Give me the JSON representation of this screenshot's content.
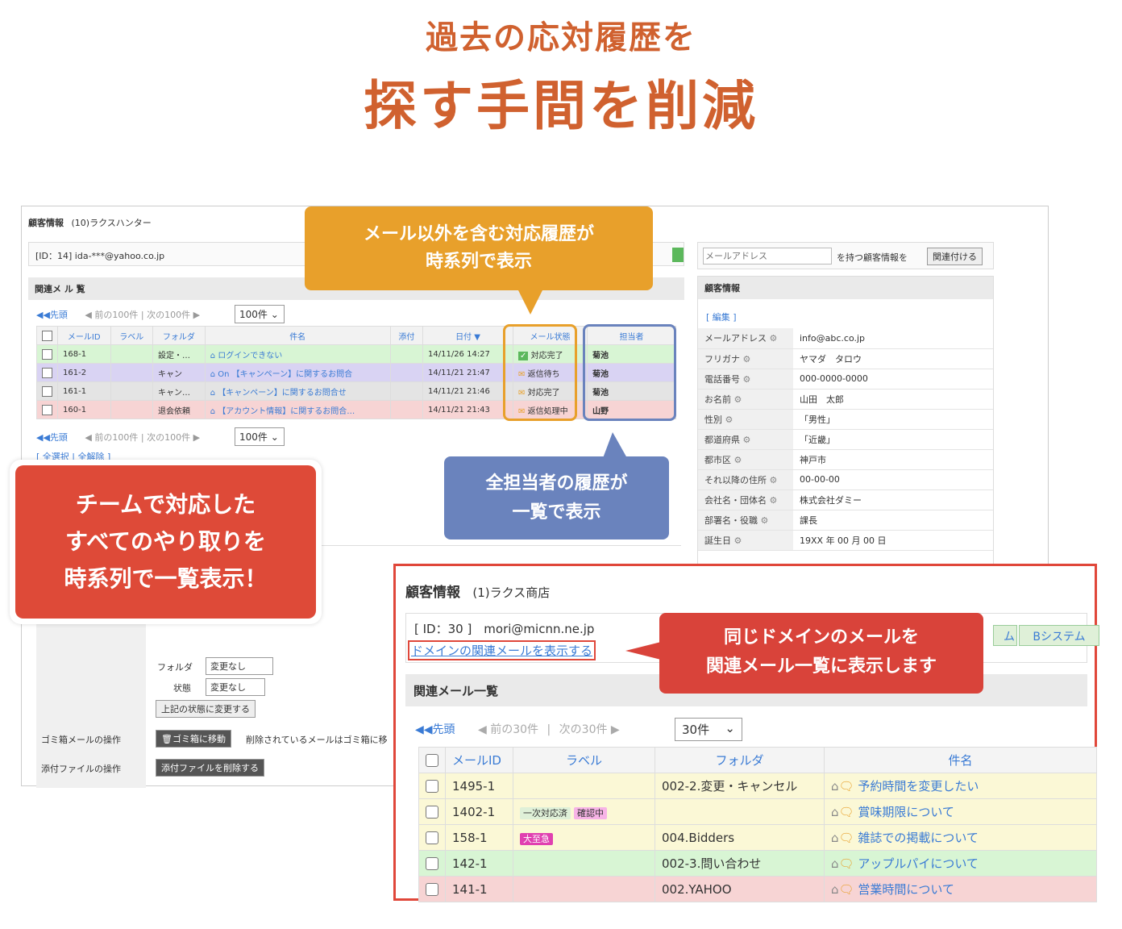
{
  "headline": {
    "line1": "過去の応対履歴を",
    "line2": "探す手間を削減"
  },
  "back": {
    "title": "顧客情報",
    "customer": "(10)ラクスハンター",
    "id_email": "[ID：14] ida-***@yahoo.co.jp",
    "related_heading": "関連メ ル 覧",
    "pager": {
      "first": "◀◀先頭",
      "prev": "◀ 前の100件",
      "next": "次の100件 ▶",
      "per_page": "100件"
    },
    "headers": [
      "メールID",
      "ラベル",
      "フォルダ",
      "件名",
      "添付",
      "日付 ▼",
      "メール状態",
      "担当者"
    ],
    "rows": [
      {
        "id": "168-1",
        "label": "",
        "folder": "設定・…",
        "subject": "ログインできない",
        "date": "14/11/26 14:27",
        "status": "対応完了",
        "agent": "菊池",
        "color": "green"
      },
      {
        "id": "161-2",
        "label": "",
        "folder": "キャン",
        "subject": "On 【キャンペーン】に関するお問合",
        "date": "14/11/21 21:47",
        "status": "返信待ち",
        "agent": "菊池",
        "color": "purple"
      },
      {
        "id": "161-1",
        "label": "",
        "folder": "キャン…",
        "subject": "【キャンペーン】に関するお問合せ",
        "date": "14/11/21 21:46",
        "status": "対応完了",
        "agent": "菊池",
        "color": "gray"
      },
      {
        "id": "160-1",
        "label": "",
        "folder": "退会依頼",
        "subject": "【アカウント情報】に関するお問合…",
        "date": "14/11/21 21:43",
        "status": "返信処理中",
        "agent": "山野",
        "color": "red"
      }
    ],
    "select_links": "[ 全選択 | 全解除 ]",
    "folder_label": "フォルダ",
    "folder_value": "変更なし",
    "status_label": "状態",
    "status_value": "変更なし",
    "apply_button": "上記の状態に変更する",
    "trash_label": "ゴミ箱メールの操作",
    "trash_button": "ゴミ箱に移動",
    "trash_note": "削除されているメールはゴミ箱に移",
    "attach_label": "添付ファイルの操作",
    "attach_button": "添付ファイルを削除する",
    "right": {
      "email_placeholder": "メールアドレス",
      "assoc_text": "を持つ顧客情報を",
      "assoc_button": "関連付ける",
      "panel_title": "顧客情報",
      "edit_link": "[ 編集 ]",
      "fields": [
        {
          "k": "メールアドレス",
          "v": "info@abc.co.jp"
        },
        {
          "k": "フリガナ",
          "v": "ヤマダ　タロウ"
        },
        {
          "k": "電話番号",
          "v": "000-0000-0000"
        },
        {
          "k": "お名前",
          "v": "山田　太郎"
        },
        {
          "k": "性別",
          "v": "「男性」"
        },
        {
          "k": "都道府県",
          "v": "「近畿」"
        },
        {
          "k": "都市区",
          "v": "神戸市"
        },
        {
          "k": "それ以降の住所",
          "v": "00-00-00"
        },
        {
          "k": "会社名・団体名",
          "v": "株式会社ダミー"
        },
        {
          "k": "部署名・役職",
          "v": "課長"
        },
        {
          "k": "誕生日",
          "v": "19XX 年 00 月 00 日"
        }
      ]
    }
  },
  "callouts": {
    "c1": [
      "メール以外を含む対応履歴が",
      "時系列で表示"
    ],
    "c2": [
      "全担当者の履歴が",
      "一覧で表示"
    ],
    "c3": [
      "チームで対応した",
      "すべてのやり取りを",
      "時系列で一覧表示！"
    ],
    "c4": [
      "同じドメインのメールを",
      "関連メール一覧に表示します"
    ]
  },
  "front": {
    "title": "顧客情報",
    "customer": "(1)ラクス商店",
    "id_email": "[ ID：30 ]　mori@micnn.ne.jp",
    "domain_link": "ドメインの関連メールを表示する",
    "tag_a": "ム",
    "tag_b": "Bシステム",
    "related_heading": "関連メール一覧",
    "pager": {
      "first": "◀◀先頭",
      "prev": "◀ 前の30件",
      "sep": "|",
      "next": "次の30件 ▶",
      "per_page": "30件"
    },
    "headers": [
      "メールID",
      "ラベル",
      "フォルダ",
      "件名"
    ],
    "rows": [
      {
        "id": "1495-1",
        "labels": [],
        "folder": "002-2.変更・キャンセル",
        "subject": "予約時間を変更したい",
        "color": "yellow"
      },
      {
        "id": "1402-1",
        "labels": [
          "一次対応済",
          "確認中"
        ],
        "folder": "",
        "subject": "賞味期限について",
        "color": "yellow"
      },
      {
        "id": "158-1",
        "labels": [
          "大至急"
        ],
        "folder": "004.Bidders",
        "subject": "雑誌での掲載について",
        "color": "yellow"
      },
      {
        "id": "142-1",
        "labels": [],
        "folder": "002-3.問い合わせ",
        "subject": "アップルパイについて",
        "color": "green"
      },
      {
        "id": "141-1",
        "labels": [],
        "folder": "002.YAHOO",
        "subject": "営業時間について",
        "color": "red"
      }
    ]
  },
  "colors": {
    "accent": "#d0612f",
    "orange": "#e8a02b",
    "blue": "#6a83bd",
    "red": "#de4a38"
  }
}
